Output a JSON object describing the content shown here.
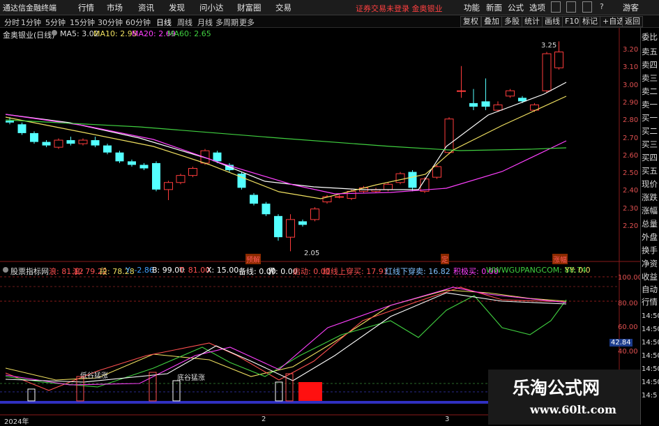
{
  "app": {
    "title": "通达信金融终端"
  },
  "menu": {
    "items": [
      "行情",
      "市场",
      "资讯",
      "发现",
      "问小达",
      "财富圈",
      "交易"
    ],
    "notice": "证券交易未登录  金奥银业",
    "right_items": [
      "功能",
      "新面",
      "公式",
      "选项"
    ],
    "window_label": "游客"
  },
  "toolbar": {
    "periods": [
      "分时",
      "1分钟",
      "5分钟",
      "15分钟",
      "30分钟",
      "60分钟",
      "日线",
      "周线",
      "月线",
      "多周期",
      "更多"
    ],
    "selected_period": "日线",
    "buttons": [
      "复权",
      "叠加",
      "多股",
      "统计",
      "画线",
      "F10",
      "标记",
      "+自选",
      "返回"
    ]
  },
  "chart": {
    "stock_name": "金奥银业(日线)",
    "ma": [
      {
        "label": "MA5: 3.02",
        "color": "#ffffff"
      },
      {
        "label": "MA10: 2.95",
        "color": "#f0e060"
      },
      {
        "label": "MA20: 2.69",
        "color": "#ff40ff"
      },
      {
        "label": "MA60: 2.65",
        "color": "#40d040"
      }
    ],
    "price_ticks": [
      "3.20",
      "3.10",
      "3.00",
      "2.90",
      "2.80",
      "2.70",
      "2.60",
      "2.50",
      "2.40",
      "2.30",
      "2.20"
    ],
    "high_label": "3.25",
    "low_label": "2.05",
    "markers": [
      "预解",
      "定",
      "涨幅"
    ]
  },
  "indicator": {
    "title": "股票指标网",
    "values": [
      {
        "label": "浪: 81.12",
        "color": "#ff5050"
      },
      {
        "label": "浪: 79.22",
        "color": "#ff5050"
      },
      {
        "label": "段: 78.28",
        "color": "#f0e060"
      },
      {
        "label": "Y: -2.86",
        "color": "#40a0ff"
      },
      {
        "label": "B: 99.00",
        "color": "#ffffff"
      },
      {
        "label": "T: 81.00",
        "color": "#ff5050"
      },
      {
        "label": "X: 15.00",
        "color": "#ffffff"
      },
      {
        "label": "备线: 0.00",
        "color": "#ffffff"
      },
      {
        "label": "界: 0.00",
        "color": "#ffffff"
      },
      {
        "label": "启动: 0.00",
        "color": "#ff5050"
      },
      {
        "label": "红线上穿买: 17.91",
        "color": "#ff5050"
      },
      {
        "label": "红线下穿卖: 16.82",
        "color": "#80c0ff"
      },
      {
        "label": "积极买: 0.00",
        "color": "#ff40ff"
      },
      {
        "label": "WWWGUPANGCOM: 80.74",
        "color": "#40d040"
      },
      {
        "label": "YY: 0.0",
        "color": "#f0e060"
      }
    ],
    "ticks": [
      "100.00",
      "80.00",
      "60.00",
      "40.00"
    ],
    "current_value": "42.84",
    "annotations": [
      "低谷猛涨",
      "底谷猛涨"
    ],
    "date_labels": [
      "2024年",
      "2",
      "3"
    ]
  },
  "side_panel": {
    "items": [
      "委比",
      "卖五",
      "卖四",
      "卖三",
      "卖二",
      "卖一",
      "买一",
      "买二",
      "买三",
      "买四",
      "买五",
      "现价",
      "涨跌",
      "涨幅",
      "总量",
      "外盘",
      "换手",
      "净资",
      "收益",
      "自动",
      "行情"
    ],
    "times": [
      "14:50",
      "14:50",
      "14:50",
      "14:50",
      "14:50",
      "14:50",
      "14:5"
    ]
  },
  "watermark": {
    "title": "乐淘公式网",
    "url": "www.60lt.com"
  }
}
